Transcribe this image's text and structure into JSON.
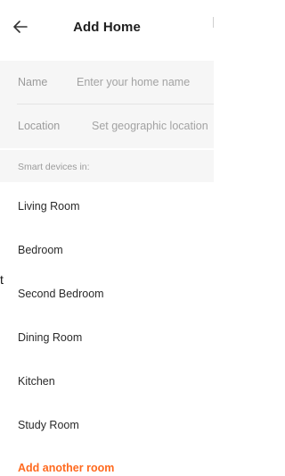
{
  "header": {
    "title": "Add Home",
    "back_icon": "arrow-left-icon"
  },
  "form": {
    "name_label": "Name",
    "name_placeholder": "Enter your home name",
    "location_label": "Location",
    "location_placeholder": "Set geographic location"
  },
  "rooms": {
    "section_title": "Smart devices in:",
    "items": [
      {
        "label": "Living Room"
      },
      {
        "label": "Bedroom"
      },
      {
        "label": "Second Bedroom"
      },
      {
        "label": "Dining Room"
      },
      {
        "label": "Kitchen"
      },
      {
        "label": "Study Room"
      }
    ],
    "add_label": "Add another room"
  },
  "stray_char": "t",
  "colors": {
    "accent": "#ff6a1f",
    "muted_text": "#9b9b9b",
    "form_background": "#f6f6f6"
  }
}
